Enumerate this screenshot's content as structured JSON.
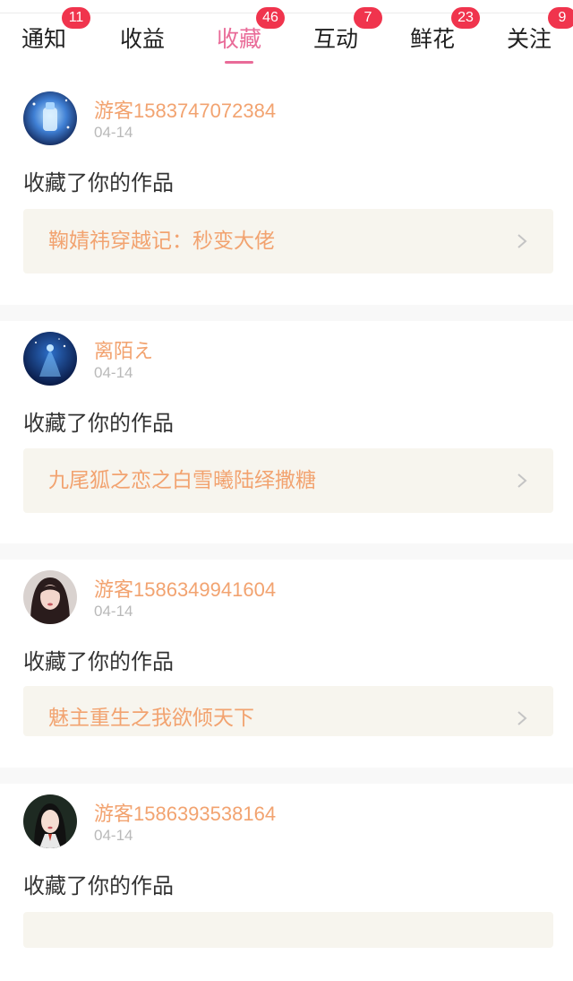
{
  "tabs": [
    {
      "label": "通知",
      "badge": "11"
    },
    {
      "label": "收益",
      "badge": ""
    },
    {
      "label": "收藏",
      "badge": "46",
      "active": true
    },
    {
      "label": "互动",
      "badge": "7"
    },
    {
      "label": "鲜花",
      "badge": "23"
    },
    {
      "label": "关注",
      "badge": "9"
    }
  ],
  "items": [
    {
      "user": "游客1583747072384",
      "date": "04-14",
      "action": "收藏了你的作品",
      "work": "鞠婧祎穿越记：秒变大佬",
      "avatar_icon": "space-bottle-avatar-icon"
    },
    {
      "user": "离陌え",
      "date": "04-14",
      "action": "收藏了你的作品",
      "work": "九尾狐之恋之白雪曦陆绎撒糖",
      "avatar_icon": "night-girl-avatar-icon"
    },
    {
      "user": "游客1586349941604",
      "date": "04-14",
      "action": "收藏了你的作品",
      "work": "魅主重生之我欲倾天下",
      "avatar_icon": "girl-portrait-avatar-icon"
    },
    {
      "user": "游客1586393538164",
      "date": "04-14",
      "action": "收藏了你的作品",
      "work": "",
      "avatar_icon": "girl-portrait-avatar-icon"
    }
  ],
  "colors": {
    "accent": "#e96b98",
    "badge": "#f0344d",
    "username": "#f2a370",
    "work_title": "#f2a370",
    "work_box": "#f7f5ee"
  }
}
